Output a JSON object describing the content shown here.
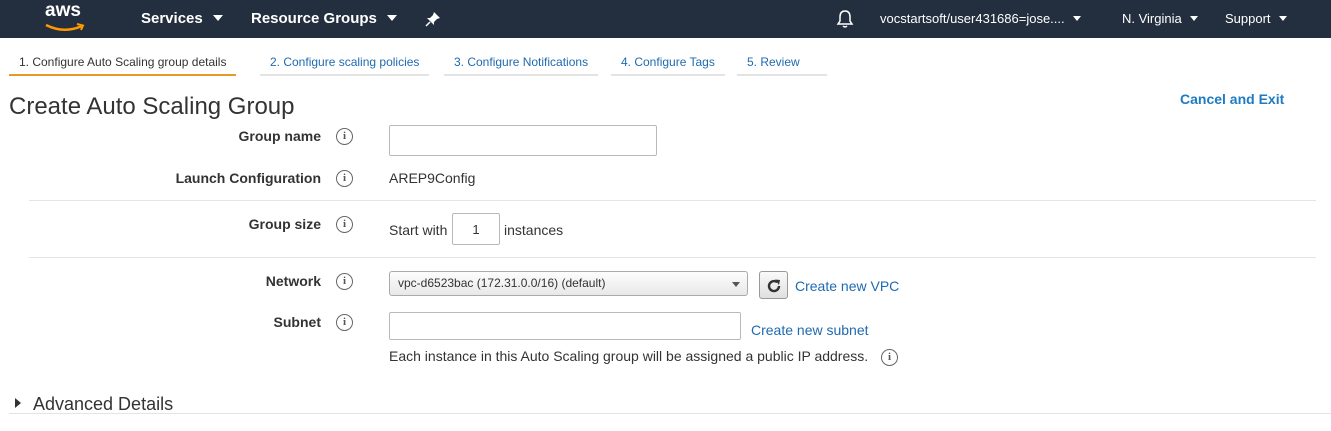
{
  "topnav": {
    "logo_text": "aws",
    "services_label": "Services",
    "resource_groups_label": "Resource Groups",
    "account_label": "vocstartsoft/user431686=jose....",
    "region_label": "N. Virginia",
    "support_label": "Support"
  },
  "wizard_tabs": [
    {
      "label": "1. Configure Auto Scaling group details",
      "active": true
    },
    {
      "label": "2. Configure scaling policies",
      "active": false
    },
    {
      "label": "3. Configure Notifications",
      "active": false
    },
    {
      "label": "4. Configure Tags",
      "active": false
    },
    {
      "label": "5. Review",
      "active": false
    }
  ],
  "page": {
    "title": "Create Auto Scaling Group",
    "cancel_label": "Cancel and Exit"
  },
  "form": {
    "group_name": {
      "label": "Group name",
      "value": ""
    },
    "launch_configuration": {
      "label": "Launch Configuration",
      "value": "AREP9Config"
    },
    "group_size": {
      "label": "Group size",
      "prefix": "Start with",
      "value": "1",
      "suffix": "instances"
    },
    "network": {
      "label": "Network",
      "selected": "vpc-d6523bac (172.31.0.0/16) (default)",
      "create_link": "Create new VPC"
    },
    "subnet": {
      "label": "Subnet",
      "value": "",
      "create_link": "Create new subnet",
      "help_text": "Each instance in this Auto Scaling group will be assigned a public IP address."
    }
  },
  "advanced": {
    "label": "Advanced Details"
  },
  "colors": {
    "nav_bg": "#232f3e",
    "accent_orange": "#e49a28",
    "link_blue": "#1f6ab0"
  }
}
